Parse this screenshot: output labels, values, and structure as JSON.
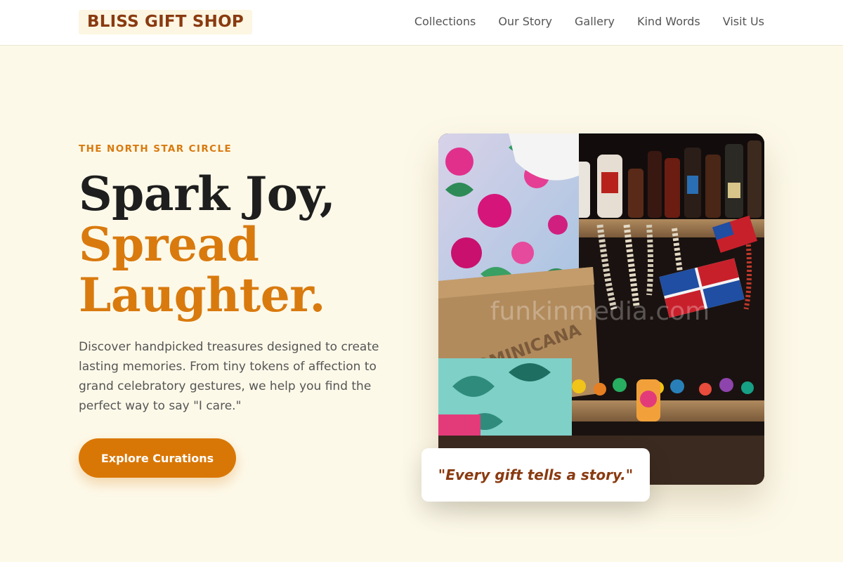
{
  "header": {
    "logo_text": "BLISS GIFT SHOP",
    "nav": [
      "Collections",
      "Our Story",
      "Gallery",
      "Kind Words",
      "Visit Us"
    ]
  },
  "hero": {
    "eyebrow": "THE NORTH STAR CIRCLE",
    "headline_line1": "Spark Joy,",
    "headline_line2": "Spread Laughter.",
    "description": "Discover handpicked treasures designed to create lasting memories. From tiny tokens of affection to grand celebratory gestures, we help you find the perfect way to say \"I care.\"",
    "cta_label": "Explore Curations",
    "image_watermark": "funkinmedia.com",
    "quote": "\"Every gift tells a story.\""
  },
  "colors": {
    "accent": "#d97706",
    "brand_dark": "#8a3a10",
    "background": "#fdf9e9"
  }
}
